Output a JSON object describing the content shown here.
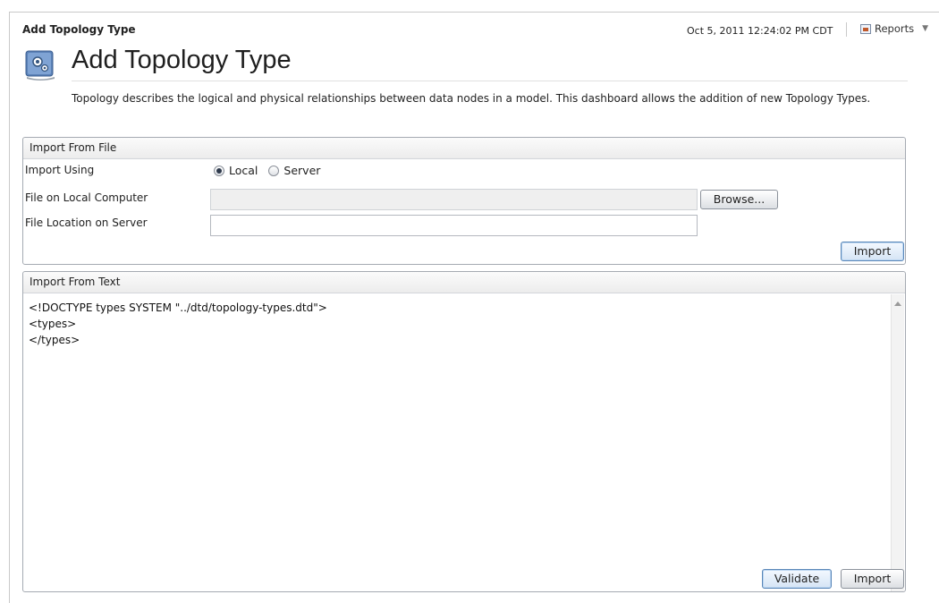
{
  "header": {
    "breadcrumb": "Add Topology Type",
    "timestamp": "Oct 5, 2011 12:24:02 PM CDT",
    "reports_label": "Reports"
  },
  "page": {
    "title": "Add Topology Type",
    "description": "Topology describes the logical and physical relationships between data nodes in a model. This dashboard allows the addition of new Topology Types."
  },
  "import_file": {
    "heading": "Import From File",
    "import_using_label": "Import Using",
    "options": [
      "Local",
      "Server"
    ],
    "selected_option": "Local",
    "local_label": "File on Local Computer",
    "local_value": "",
    "browse_label": "Browse...",
    "server_label": "File Location on Server",
    "server_value": "",
    "import_label": "Import"
  },
  "import_text": {
    "heading": "Import From Text",
    "content": "<!DOCTYPE types SYSTEM \"../dtd/topology-types.dtd\">\n<types>\n</types>",
    "validate_label": "Validate",
    "import_label": "Import"
  },
  "icons": {
    "page_icon": "gear-document-icon",
    "reports_icon": "report-icon",
    "dropdown_icon": "chevron-down-icon"
  }
}
